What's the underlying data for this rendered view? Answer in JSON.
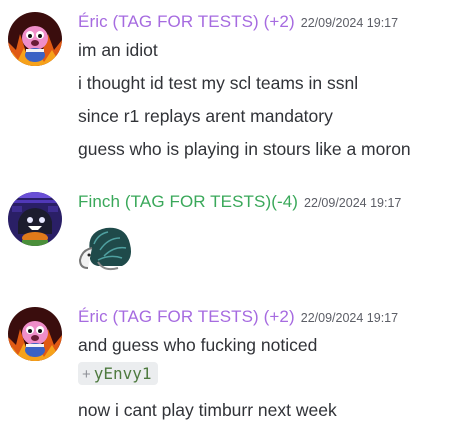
{
  "messages": [
    {
      "username": "Éric (TAG FOR TESTS) (+2)",
      "username_color": "#a66be0",
      "timestamp": "22/09/2024 19:17",
      "lines": [
        "im an idiot",
        "i thought id test my scl teams in ssnl",
        "since r1 replays arent mandatory",
        "guess who is playing in stours like a moron"
      ]
    },
    {
      "username": "Finch (TAG FOR TESTS)(-4)",
      "username_color": "#3aa85a",
      "timestamp": "22/09/2024 19:17",
      "sticker": "mammoth-sticker-icon"
    },
    {
      "username": "Éric (TAG FOR TESTS) (+2)",
      "username_color": "#a66be0",
      "timestamp": "22/09/2024 19:17",
      "line_before": "and guess who fucking noticed",
      "mention": {
        "plus": "+",
        "text": "yEnvy1"
      },
      "line_after": "now i cant play timburr next week"
    }
  ]
}
